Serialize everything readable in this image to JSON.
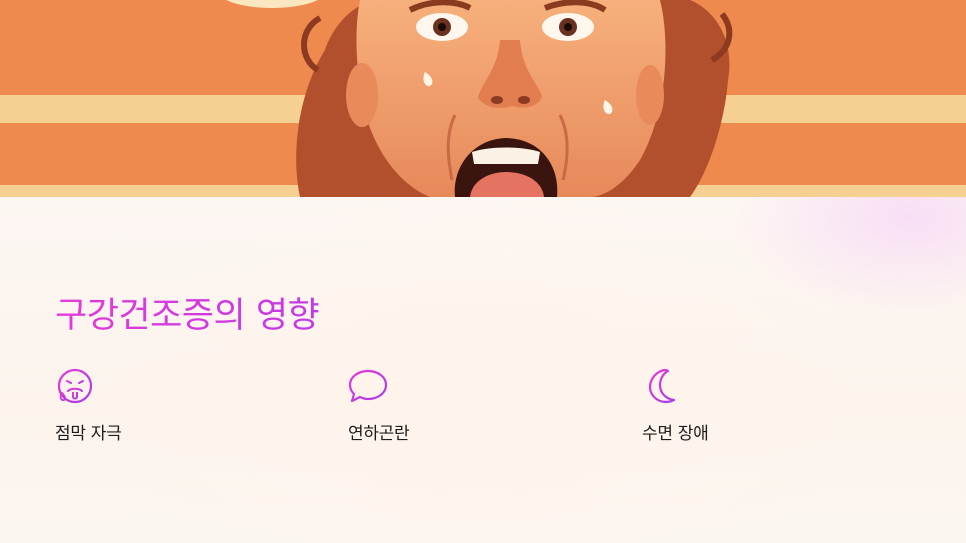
{
  "section": {
    "title": "구강건조증의 영향",
    "items": [
      {
        "icon": "drooling-face-icon",
        "label": "점막 자극"
      },
      {
        "icon": "speech-bubble-icon",
        "label": "연하곤란"
      },
      {
        "icon": "crescent-moon-icon",
        "label": "수면 장애"
      }
    ]
  },
  "hero": {
    "icon": "shocked-face-illustration"
  },
  "colors": {
    "accent_start": "#e43ad7",
    "accent_end": "#c23ae6",
    "hero_orange": "#f08a4c"
  }
}
